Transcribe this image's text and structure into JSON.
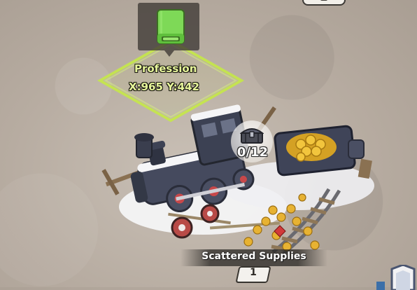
{
  "marker": {
    "title": "Profession",
    "coords": "X:965 Y:442",
    "icon": "book-icon",
    "accent_color": "#c6e84a"
  },
  "site": {
    "name": "Scattered Supplies",
    "level": "1",
    "collected": "0/12",
    "icon": "chest-icon"
  }
}
